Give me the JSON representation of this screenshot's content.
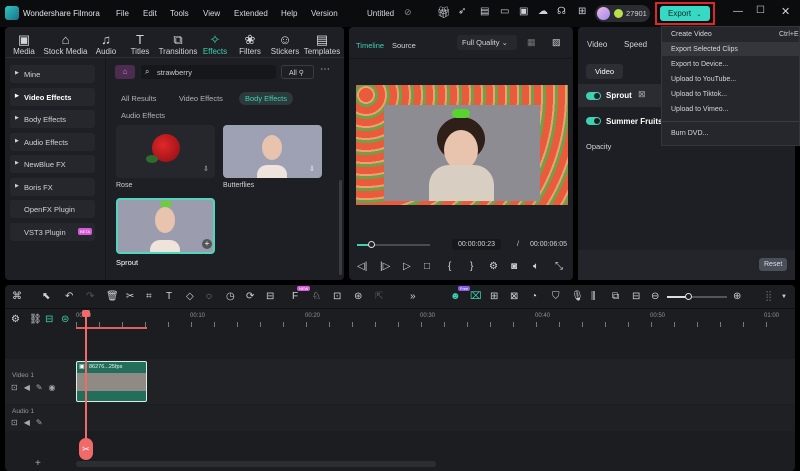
{
  "app": {
    "name": "Wondershare Filmora",
    "project": "Untitled",
    "credits": "27901",
    "export_label": "Export"
  },
  "menu": [
    "File",
    "Edit",
    "Tools",
    "View",
    "Extended",
    "Help",
    "Version"
  ],
  "toolbar": [
    "Media",
    "Stock Media",
    "Audio",
    "Titles",
    "Transitions",
    "Effects",
    "Filters",
    "Stickers",
    "Templates"
  ],
  "sidebar": [
    "Mine",
    "Video Effects",
    "Body Effects",
    "Audio Effects",
    "NewBlue FX",
    "Boris FX",
    "OpenFX Plugin",
    "VST3 Plugin"
  ],
  "sidebar_badge": "BETA",
  "search": {
    "value": "strawberry",
    "filter": "All"
  },
  "filters": [
    "All Results",
    "Video Effects",
    "Body Effects",
    "Audio Effects"
  ],
  "effects": [
    {
      "name": "Rose"
    },
    {
      "name": "Butterflies"
    },
    {
      "name": "Sprout"
    }
  ],
  "preview": {
    "tabs": [
      "Timeline",
      "Source"
    ],
    "quality": "Full Quality",
    "current_time": "00:00:00:23",
    "separator": "/",
    "total_time": "00:00:06:05",
    "progress": 0.2
  },
  "properties": {
    "tabs": [
      "Video",
      "Speed"
    ],
    "subtab": "Video",
    "layers": [
      "Sprout",
      "Summer Fruits F"
    ],
    "opacity_label": "Opacity",
    "reset": "Reset"
  },
  "export_menu": [
    {
      "label": "Create Video",
      "shortcut": "Ctrl+E"
    },
    {
      "label": "Export Selected Clips"
    },
    {
      "label": "Export to Device..."
    },
    {
      "label": "Upload to YouTube..."
    },
    {
      "label": "Upload to Tiktok..."
    },
    {
      "label": "Upload to Vimeo..."
    },
    {
      "label": "Burn DVD..."
    }
  ],
  "timeline": {
    "ruler": [
      "00:00",
      "00:10",
      "00:20",
      "00:30",
      "00:40",
      "00:50",
      "01:00"
    ],
    "tracks": [
      "Video 1",
      "Audio 1"
    ],
    "clip": "86276...25fps",
    "badge_new": "NEW",
    "badge_free": "Free",
    "zoom_level": 0.35
  },
  "colors": {
    "accent": "#3fd0b1",
    "export_bg": "#37d8c4",
    "highlight": "#e0262b",
    "playhead": "#f06a6a"
  }
}
